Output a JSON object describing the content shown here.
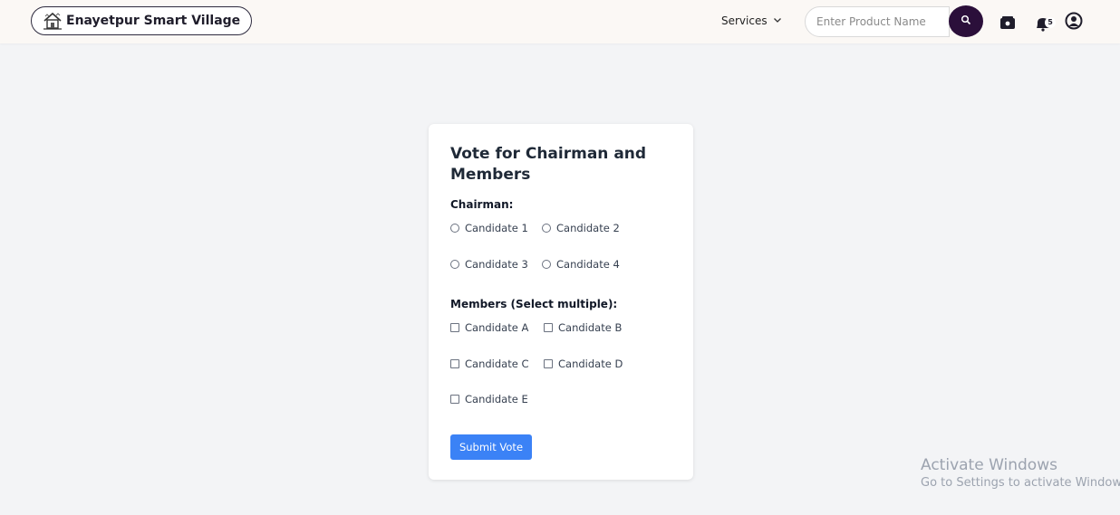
{
  "header": {
    "brand_name": "Enayetpur Smart Village",
    "services_label": "Services",
    "search": {
      "placeholder": "Enter Product Name",
      "value": ""
    },
    "notification_count": "5",
    "colors": {
      "background": "#fbf8f5",
      "search_button": "#2b0f3a"
    }
  },
  "vote_form": {
    "title": "Vote for Chairman and Members",
    "chairman": {
      "label": "Chairman:",
      "options": [
        "Candidate 1",
        "Candidate 2",
        "Candidate 3",
        "Candidate 4"
      ]
    },
    "members": {
      "label": "Members (Select multiple):",
      "options": [
        "Candidate A",
        "Candidate B",
        "Candidate C",
        "Candidate D",
        "Candidate E"
      ]
    },
    "submit_label": "Submit Vote",
    "colors": {
      "submit": "#3b82f6"
    }
  },
  "watermark": {
    "title": "Activate Windows",
    "subtitle": "Go to Settings to activate Windows."
  },
  "icons": [
    "home-logo-icon",
    "chevron-down-icon",
    "search-icon",
    "cart-icon",
    "bell-icon",
    "user-icon"
  ]
}
